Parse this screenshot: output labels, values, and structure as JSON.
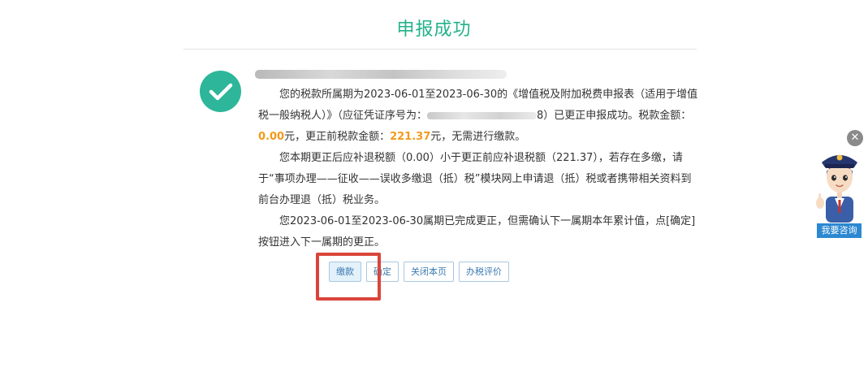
{
  "page": {
    "title": "申报成功",
    "accent_color": "#23b28a",
    "icon": "check-circle-icon"
  },
  "message": {
    "p1_a": "您的税款所属期为2023-06-01至2023-06-30的《增值税及附加税费申报表（适用于增值税一般纳税人）》（应征凭证序号为：",
    "p1_b": "8）已更正申报成功。税款金额：",
    "p1_amount": "0.00",
    "p1_c": "元，更正前税款金额：",
    "p1_prev_amount": "221.37",
    "p1_d": "元，无需进行缴款。",
    "p2": "您本期更正后应补退税额（0.00）小于更正前应补退税额（221.37），若存在多缴，请于“事项办理——征收——误收多缴退（抵）税”模块网上申请退（抵）税或者携带相关资料到前台办理退（抵）税业务。",
    "p3": "您2023-06-01至2023-06-30属期已完成更正，但需确认下一属期本年累计值，点[确定]按钮进入下一属期的更正。",
    "highlight_color": "#f39a1a"
  },
  "buttons": {
    "pay": "缴款",
    "confirm": "确定",
    "close_page": "关闭本页",
    "rate": "办税评价"
  },
  "assistant": {
    "label": "我要咨询",
    "close_icon": "close-icon",
    "avatar": "customer-service-avatar"
  },
  "annotation": {
    "color": "#d9453a"
  }
}
